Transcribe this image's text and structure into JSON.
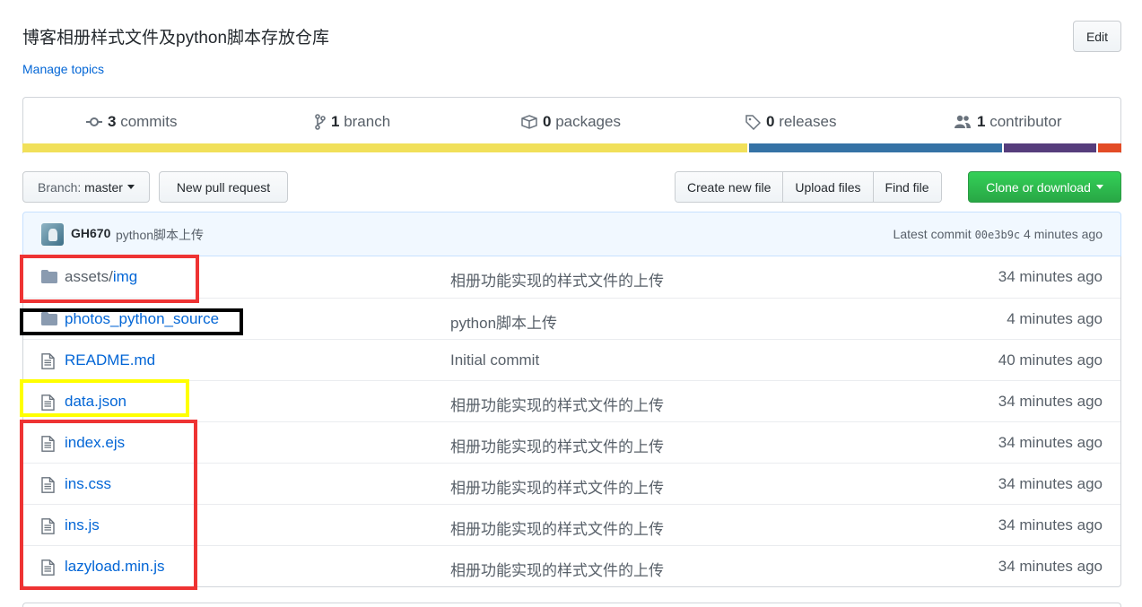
{
  "repo": {
    "description": "博客相册样式文件及python脚本存放仓库",
    "edit_label": "Edit",
    "manage_topics": "Manage topics"
  },
  "summary": {
    "commits_count": "3",
    "commits_label": " commits",
    "branch_count": "1",
    "branch_label": " branch",
    "packages_count": "0",
    "packages_label": " packages",
    "releases_count": "0",
    "releases_label": " releases",
    "contributors_count": "1",
    "contributors_label": " contributor"
  },
  "language_bar": [
    {
      "color": "#f1e05a",
      "percent": 66.3
    },
    {
      "color": "#3572A5",
      "percent": 23.1
    },
    {
      "color": "#563d7c",
      "percent": 8.5
    },
    {
      "color": "#e34c26",
      "percent": 2.1
    }
  ],
  "toolbar": {
    "branch_prefix": "Branch: ",
    "branch_name": "master",
    "new_pull_request": "New pull request",
    "create_new_file": "Create new file",
    "upload_files": "Upload files",
    "find_file": "Find file",
    "clone_or_download": "Clone or download"
  },
  "latest_commit": {
    "author": "GH670",
    "message": "python脚本上传",
    "prefix": "Latest commit",
    "sha": "00e3b9c",
    "age": "4 minutes ago"
  },
  "files": [
    {
      "type": "dir",
      "dir": "assets/",
      "name": "img",
      "message": "相册功能实现的样式文件的上传",
      "age": "34 minutes ago"
    },
    {
      "type": "dir",
      "dir": "",
      "name": "photos_python_source",
      "message": "python脚本上传",
      "age": "4 minutes ago"
    },
    {
      "type": "file",
      "dir": "",
      "name": "README.md",
      "message": "Initial commit",
      "age": "40 minutes ago"
    },
    {
      "type": "file",
      "dir": "",
      "name": "data.json",
      "message": "相册功能实现的样式文件的上传",
      "age": "34 minutes ago"
    },
    {
      "type": "file",
      "dir": "",
      "name": "index.ejs",
      "message": "相册功能实现的样式文件的上传",
      "age": "34 minutes ago"
    },
    {
      "type": "file",
      "dir": "",
      "name": "ins.css",
      "message": "相册功能实现的样式文件的上传",
      "age": "34 minutes ago"
    },
    {
      "type": "file",
      "dir": "",
      "name": "ins.js",
      "message": "相册功能实现的样式文件的上传",
      "age": "34 minutes ago"
    },
    {
      "type": "file",
      "dir": "",
      "name": "lazyload.min.js",
      "message": "相册功能实现的样式文件的上传",
      "age": "34 minutes ago"
    }
  ],
  "annotation_colors": {
    "red": "#ee3333",
    "black": "#000000",
    "yellow": "#ffff00"
  }
}
